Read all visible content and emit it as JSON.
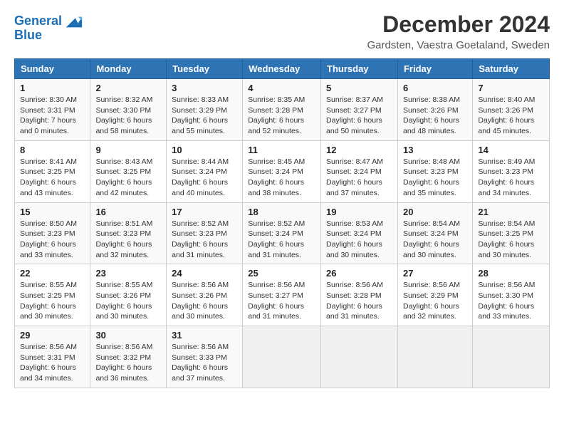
{
  "header": {
    "logo_line1": "General",
    "logo_line2": "Blue",
    "title": "December 2024",
    "subtitle": "Gardsten, Vaestra Goetaland, Sweden"
  },
  "weekdays": [
    "Sunday",
    "Monday",
    "Tuesday",
    "Wednesday",
    "Thursday",
    "Friday",
    "Saturday"
  ],
  "weeks": [
    [
      {
        "day": "1",
        "sunrise": "8:30 AM",
        "sunset": "3:31 PM",
        "daylight": "7 hours and 0 minutes."
      },
      {
        "day": "2",
        "sunrise": "8:32 AM",
        "sunset": "3:30 PM",
        "daylight": "6 hours and 58 minutes."
      },
      {
        "day": "3",
        "sunrise": "8:33 AM",
        "sunset": "3:29 PM",
        "daylight": "6 hours and 55 minutes."
      },
      {
        "day": "4",
        "sunrise": "8:35 AM",
        "sunset": "3:28 PM",
        "daylight": "6 hours and 52 minutes."
      },
      {
        "day": "5",
        "sunrise": "8:37 AM",
        "sunset": "3:27 PM",
        "daylight": "6 hours and 50 minutes."
      },
      {
        "day": "6",
        "sunrise": "8:38 AM",
        "sunset": "3:26 PM",
        "daylight": "6 hours and 48 minutes."
      },
      {
        "day": "7",
        "sunrise": "8:40 AM",
        "sunset": "3:26 PM",
        "daylight": "6 hours and 45 minutes."
      }
    ],
    [
      {
        "day": "8",
        "sunrise": "8:41 AM",
        "sunset": "3:25 PM",
        "daylight": "6 hours and 43 minutes."
      },
      {
        "day": "9",
        "sunrise": "8:43 AM",
        "sunset": "3:25 PM",
        "daylight": "6 hours and 42 minutes."
      },
      {
        "day": "10",
        "sunrise": "8:44 AM",
        "sunset": "3:24 PM",
        "daylight": "6 hours and 40 minutes."
      },
      {
        "day": "11",
        "sunrise": "8:45 AM",
        "sunset": "3:24 PM",
        "daylight": "6 hours and 38 minutes."
      },
      {
        "day": "12",
        "sunrise": "8:47 AM",
        "sunset": "3:24 PM",
        "daylight": "6 hours and 37 minutes."
      },
      {
        "day": "13",
        "sunrise": "8:48 AM",
        "sunset": "3:23 PM",
        "daylight": "6 hours and 35 minutes."
      },
      {
        "day": "14",
        "sunrise": "8:49 AM",
        "sunset": "3:23 PM",
        "daylight": "6 hours and 34 minutes."
      }
    ],
    [
      {
        "day": "15",
        "sunrise": "8:50 AM",
        "sunset": "3:23 PM",
        "daylight": "6 hours and 33 minutes."
      },
      {
        "day": "16",
        "sunrise": "8:51 AM",
        "sunset": "3:23 PM",
        "daylight": "6 hours and 32 minutes."
      },
      {
        "day": "17",
        "sunrise": "8:52 AM",
        "sunset": "3:23 PM",
        "daylight": "6 hours and 31 minutes."
      },
      {
        "day": "18",
        "sunrise": "8:52 AM",
        "sunset": "3:24 PM",
        "daylight": "6 hours and 31 minutes."
      },
      {
        "day": "19",
        "sunrise": "8:53 AM",
        "sunset": "3:24 PM",
        "daylight": "6 hours and 30 minutes."
      },
      {
        "day": "20",
        "sunrise": "8:54 AM",
        "sunset": "3:24 PM",
        "daylight": "6 hours and 30 minutes."
      },
      {
        "day": "21",
        "sunrise": "8:54 AM",
        "sunset": "3:25 PM",
        "daylight": "6 hours and 30 minutes."
      }
    ],
    [
      {
        "day": "22",
        "sunrise": "8:55 AM",
        "sunset": "3:25 PM",
        "daylight": "6 hours and 30 minutes."
      },
      {
        "day": "23",
        "sunrise": "8:55 AM",
        "sunset": "3:26 PM",
        "daylight": "6 hours and 30 minutes."
      },
      {
        "day": "24",
        "sunrise": "8:56 AM",
        "sunset": "3:26 PM",
        "daylight": "6 hours and 30 minutes."
      },
      {
        "day": "25",
        "sunrise": "8:56 AM",
        "sunset": "3:27 PM",
        "daylight": "6 hours and 31 minutes."
      },
      {
        "day": "26",
        "sunrise": "8:56 AM",
        "sunset": "3:28 PM",
        "daylight": "6 hours and 31 minutes."
      },
      {
        "day": "27",
        "sunrise": "8:56 AM",
        "sunset": "3:29 PM",
        "daylight": "6 hours and 32 minutes."
      },
      {
        "day": "28",
        "sunrise": "8:56 AM",
        "sunset": "3:30 PM",
        "daylight": "6 hours and 33 minutes."
      }
    ],
    [
      {
        "day": "29",
        "sunrise": "8:56 AM",
        "sunset": "3:31 PM",
        "daylight": "6 hours and 34 minutes."
      },
      {
        "day": "30",
        "sunrise": "8:56 AM",
        "sunset": "3:32 PM",
        "daylight": "6 hours and 36 minutes."
      },
      {
        "day": "31",
        "sunrise": "8:56 AM",
        "sunset": "3:33 PM",
        "daylight": "6 hours and 37 minutes."
      },
      null,
      null,
      null,
      null
    ]
  ]
}
